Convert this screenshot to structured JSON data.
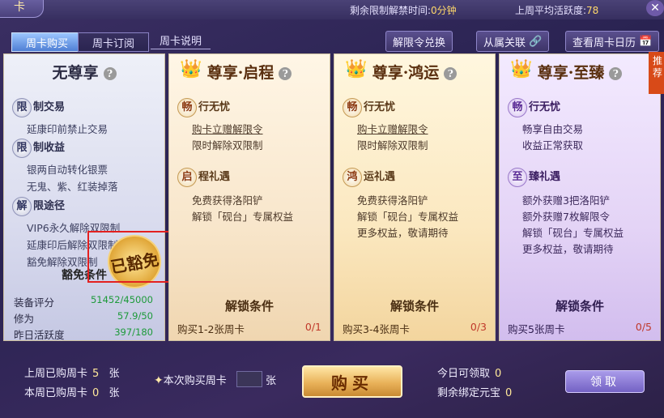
{
  "window": {
    "title": "卡"
  },
  "top": {
    "remaining_label": "剩余限制解禁时间:",
    "remaining_value": "0分钟",
    "avg_label": "上周平均活跃度:",
    "avg_value": "78"
  },
  "tabs": [
    {
      "label": "周卡购买"
    },
    {
      "label": "周卡订阅"
    },
    {
      "label": "周卡说明"
    }
  ],
  "toolbar": {
    "exchange": "解限令兑换",
    "bind": "从属关联",
    "calendar": "查看周卡日历"
  },
  "cards": {
    "none": {
      "title": "无尊享",
      "sections": [
        {
          "badge": "限",
          "label": "制交易",
          "lines": [
            "延康印前禁止交易"
          ]
        },
        {
          "badge": "限",
          "label": "制收益",
          "lines": [
            "银两自动转化银票",
            "无鬼、紫、红装掉落"
          ]
        },
        {
          "badge": "解",
          "label": "限途径",
          "lines": [
            "VIP6永久解除双限制",
            "延康印后解除双限制",
            "豁免解除双限制"
          ]
        }
      ],
      "cond_title": "豁免条件",
      "stats": [
        {
          "label": "装备评分",
          "value": "51452/45000"
        },
        {
          "label": "修为",
          "value": "57.9/50"
        },
        {
          "label": "昨日活跃度",
          "value": "397/180"
        }
      ],
      "stamp_text": "已豁免"
    },
    "qi": {
      "title": "尊享·启程",
      "sections": [
        {
          "badge": "畅",
          "label": "行无忧",
          "lines": [
            "购卡立赠解限令",
            "限时解除双限制"
          ]
        },
        {
          "badge": "启",
          "label": "程礼遇",
          "lines": [
            "免费获得洛阳铲",
            "解锁「砚台」专属权益"
          ]
        }
      ],
      "cond_title": "解锁条件",
      "cond_text": "购买1-2张周卡",
      "cond_num": "0/1"
    },
    "hong": {
      "title": "尊享·鸿运",
      "sections": [
        {
          "badge": "畅",
          "label": "行无忧",
          "lines": [
            "购卡立赠解限令",
            "限时解除双限制"
          ]
        },
        {
          "badge": "鸿",
          "label": "运礼遇",
          "lines": [
            "免费获得洛阳铲",
            "解锁「砚台」专属权益",
            "更多权益，敬请期待"
          ]
        }
      ],
      "cond_title": "解锁条件",
      "cond_text": "购买3-4张周卡",
      "cond_num": "0/3"
    },
    "zhi": {
      "title": "尊享·至臻",
      "sections": [
        {
          "badge": "畅",
          "label": "行无忧",
          "lines": [
            "畅享自由交易",
            "收益正常获取"
          ]
        },
        {
          "badge": "至",
          "label": "臻礼遇",
          "lines": [
            "额外获赠3把洛阳铲",
            "额外获赠7枚解限令",
            "解锁「砚台」专属权益",
            "更多权益，敬请期待"
          ]
        }
      ],
      "cond_title": "解锁条件",
      "cond_text": "购买5张周卡",
      "cond_num": "0/5"
    }
  },
  "ribbon": "推荐",
  "bottom": {
    "last_week_label": "上周已购周卡",
    "last_week_value": "5",
    "this_week_label": "本周已购周卡",
    "this_week_value": "0",
    "unit": "张",
    "buy_qty_label": "本次购买周卡",
    "buy_qty_unit": "张",
    "buy_button": "购买",
    "today_label": "今日可领取",
    "today_value": "0",
    "remain_label": "剩余绑定元宝",
    "remain_value": "0",
    "claim_button": "领取"
  }
}
